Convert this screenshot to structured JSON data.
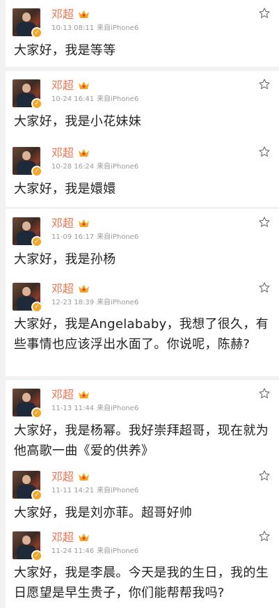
{
  "posts": [
    {
      "author": "邓超",
      "time": "10-13 08:11",
      "source": "来自iPhone6",
      "text": "大家好，我是等等"
    },
    {
      "author": "邓超",
      "time": "10-24 16:41",
      "source": "来自iPhone6",
      "text": "大家好，我是小花妹妹"
    },
    {
      "author": "邓超",
      "time": "10-28 16:24",
      "source": "来自iPhone6",
      "text": "大家好，我是嬛嬛"
    },
    {
      "author": "邓超",
      "time": "11-09 16:17",
      "source": "来自iPhone6",
      "text": "大家好，我是孙杨"
    },
    {
      "author": "邓超",
      "time": "12-23 18:39",
      "source": "来自iPhone6",
      "text": "大家好，我是Angelababy，我想了很久，有些事情也应该浮出水面了。你说呢，陈赫?"
    },
    {
      "author": "邓超",
      "time": "11-13 11:44",
      "source": "来自iPhone6",
      "text": "大家好，我是杨幂。我好崇拜超哥，现在就为他高歌一曲《爱的供养》"
    },
    {
      "author": "邓超",
      "time": "11-11 14:21",
      "source": "来自iPhone6",
      "text": "大家好，我是刘亦菲。超哥好帅"
    },
    {
      "author": "邓超",
      "time": "11-24 11:46",
      "source": "来自iPhone6",
      "text": "大家好，我是李晨。今天是我的生日，我的生日愿望是早生贵子，你们能帮帮我吗?"
    }
  ],
  "colors": {
    "name": "#eb7350",
    "meta": "#9a9a9a",
    "text": "#222222",
    "badge": "#f5a623"
  },
  "icons": {
    "favorite": "star-outline-icon",
    "verified": "verified-badge-icon",
    "vip": "vip-crown-icon"
  }
}
